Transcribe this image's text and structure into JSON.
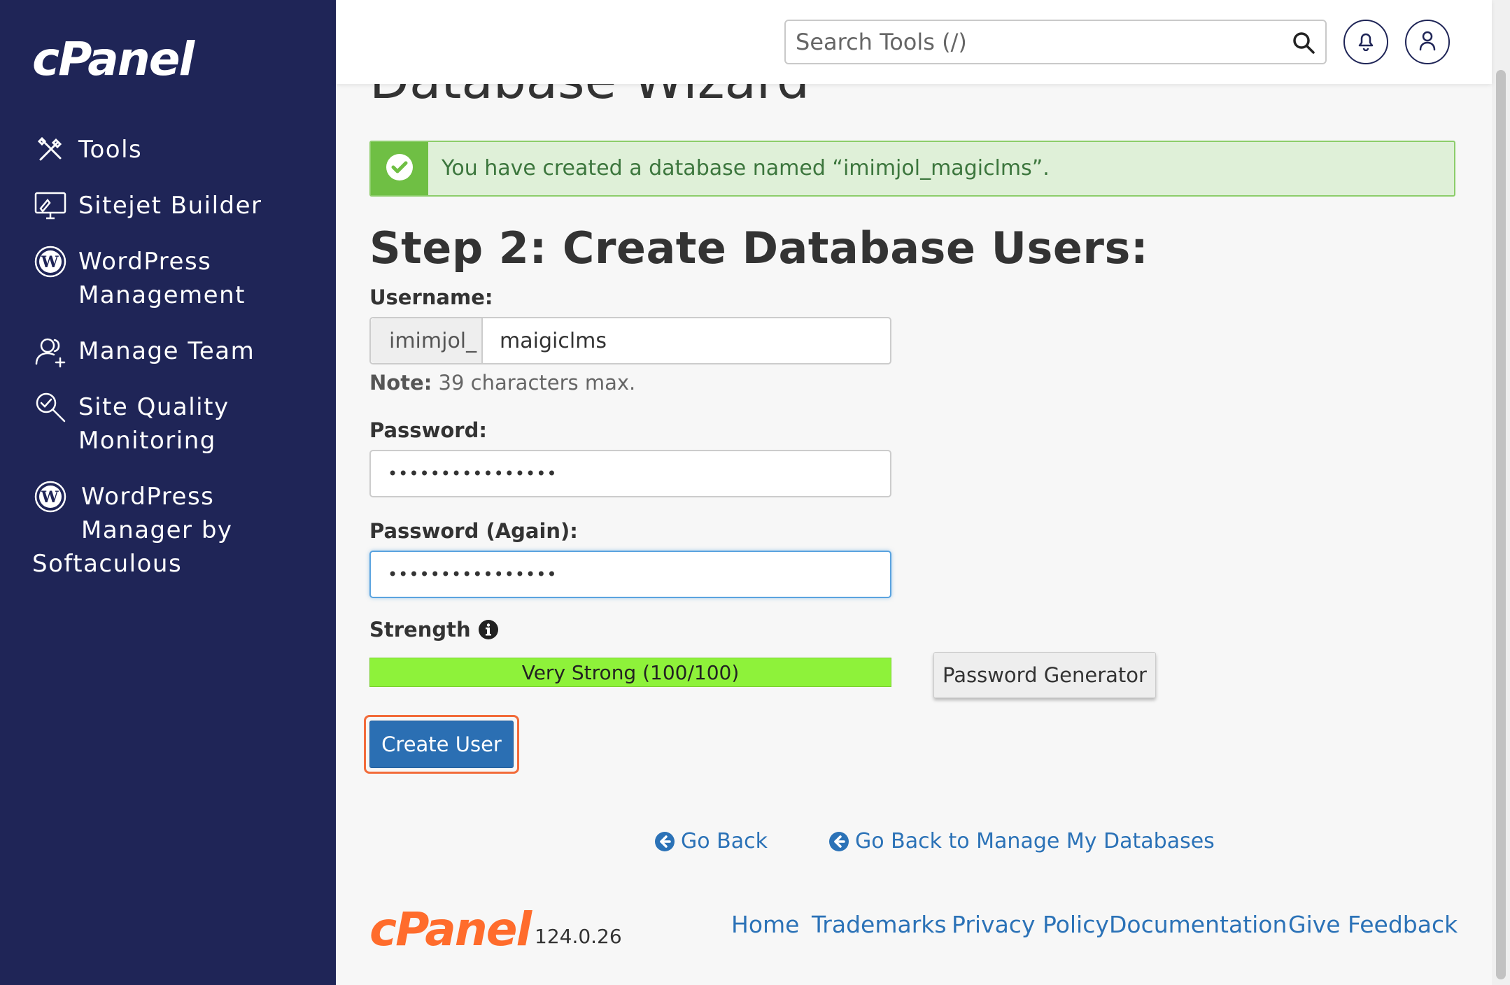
{
  "brand": {
    "logo_text": "cPanel"
  },
  "sidebar": {
    "items": [
      {
        "label": "Tools",
        "icon": "tools-icon"
      },
      {
        "label": "Sitejet Builder",
        "icon": "sitejet-icon"
      },
      {
        "label": "WordPress Management",
        "line1": "WordPress",
        "line2": "Management",
        "icon": "wordpress-icon"
      },
      {
        "label": "Manage Team",
        "icon": "manage-team-icon"
      },
      {
        "label": "Site Quality Monitoring",
        "line1": "Site Quality",
        "line2": "Monitoring",
        "icon": "site-quality-icon"
      },
      {
        "label": "WordPress Manager by Softaculous",
        "line1": "WordPress",
        "line2": "Manager by",
        "line3": "Softaculous",
        "icon": "wordpress-icon"
      }
    ]
  },
  "header": {
    "search_placeholder": "Search Tools (/)"
  },
  "main": {
    "page_title": "Database Wizard",
    "alert_message": "You have created a database named “imimjol_magiclms”.",
    "step_title": "Step 2: Create Database Users:",
    "username_label": "Username:",
    "username_prefix": "imimjol_",
    "username_value": "maigiclms",
    "note_bold": "Note:",
    "note_text": " 39 characters max.",
    "password_label": "Password:",
    "password_value": "••••••••••••••••",
    "password_again_label": "Password (Again):",
    "password_again_value": "••••••••••••••••",
    "strength_label": "Strength",
    "strength_text": "Very Strong (100/100)",
    "strength_score": 100,
    "password_generator_label": "Password Generator",
    "create_user_label": "Create User",
    "go_back_label": "Go Back",
    "go_back_manage_label": "Go Back to Manage My Databases"
  },
  "footer": {
    "version": "124.0.26",
    "links": [
      "Home",
      "Trademarks",
      "Privacy Policy",
      "Documentation",
      "Give Feedback"
    ]
  },
  "colors": {
    "sidebar_bg": "#1f2557",
    "accent_orange": "#ff6c2c",
    "link_blue": "#2b72b7",
    "button_blue": "#2b6fb3",
    "success_green": "#6fbf44",
    "strength_green": "#8ef23a"
  }
}
